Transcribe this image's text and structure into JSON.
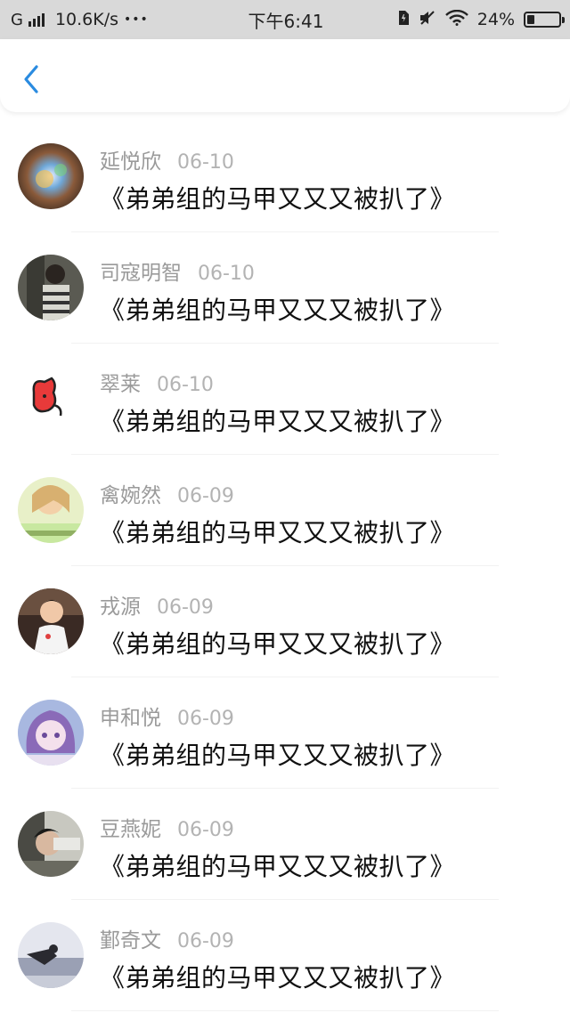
{
  "status_bar": {
    "network_letter": "G",
    "speed": "10.6K/s",
    "dots": "•••",
    "time": "下午6:41",
    "battery_percent": "24%",
    "battery_level": 0.24,
    "icons": [
      "signal-bars-icon",
      "sim-card-icon",
      "mute-icon",
      "wifi-icon",
      "battery-icon"
    ]
  },
  "nav": {
    "back_icon": "chevron-left-icon",
    "accent_color": "#2a8be0"
  },
  "messages": [
    {
      "name": "延悦欣",
      "date": "06-10",
      "text": "《弟弟组的马甲又又又被扒了》"
    },
    {
      "name": "司寇明智",
      "date": "06-10",
      "text": "《弟弟组的马甲又又又被扒了》"
    },
    {
      "name": "翠莱",
      "date": "06-10",
      "text": "《弟弟组的马甲又又又被扒了》"
    },
    {
      "name": "禽婉然",
      "date": "06-09",
      "text": "《弟弟组的马甲又又又被扒了》"
    },
    {
      "name": "戎源",
      "date": "06-09",
      "text": "《弟弟组的马甲又又又被扒了》"
    },
    {
      "name": "申和悦",
      "date": "06-09",
      "text": "《弟弟组的马甲又又又被扒了》"
    },
    {
      "name": "豆燕妮",
      "date": "06-09",
      "text": "《弟弟组的马甲又又又被扒了》"
    },
    {
      "name": "鄞奇文",
      "date": "06-09",
      "text": "《弟弟组的马甲又又又被扒了》"
    }
  ]
}
